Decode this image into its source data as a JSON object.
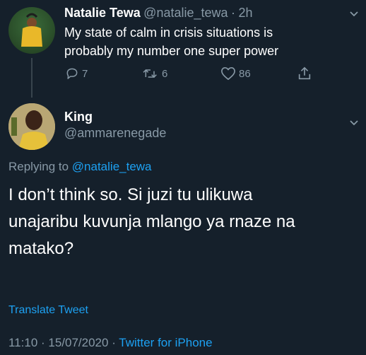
{
  "original_tweet": {
    "name": "Natalie Tewa",
    "handle": "@natalie_tewa",
    "separator": "·",
    "time": "2h",
    "text_line1": "My state of calm in crisis situations is",
    "text_line2": "probably my number one super power",
    "replies": "7",
    "retweets": "6",
    "likes": "86"
  },
  "reply_tweet": {
    "name": "King",
    "handle": "@ammarenegade",
    "replying_prefix": "Replying to",
    "replying_to": "@natalie_tewa",
    "text_line1": "I don’t think so. Si juzi tu ulikuwa",
    "text_line2": "unajaribu kuvunja mlango ya rnaze na",
    "text_line3": "matako?",
    "translate_label": "Translate Tweet",
    "timestamp": "11:10 · 15/07/2020 · ",
    "source": "Twitter for iPhone"
  },
  "colors": {
    "background": "#15202b",
    "accent": "#1da1f2",
    "muted": "#8899a6"
  },
  "icons": [
    "reply-icon",
    "retweet-icon",
    "like-icon",
    "share-icon",
    "chevron-down-icon"
  ]
}
